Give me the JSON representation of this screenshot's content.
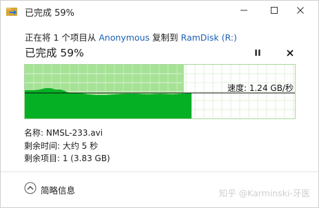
{
  "window": {
    "title": "已完成 59%",
    "icon": "copy-arrow-icon"
  },
  "header": {
    "copy_prefix": "正在将 1 个项目从 ",
    "source": "Anonymous",
    "copy_middle": " 复制到 ",
    "destination": "RamDisk (R:)",
    "progress_title": "已完成 59%",
    "progress_fraction": 0.59
  },
  "graph": {
    "speed_label": "速度: 1.24 GB/秒",
    "colors": {
      "completed_bg": "#a6e296",
      "fill": "#06b025",
      "grid_done": "#c4eebb",
      "grid_remaining": "#dff2da",
      "speed_line": "#111111"
    }
  },
  "details": {
    "name_label": "名称: ",
    "name_value": "NMSL-233.avi",
    "time_label": "剩余时间: ",
    "time_value": "大约 5 秒",
    "items_label": "剩余项目: ",
    "items_value": "1 (3.83 GB)"
  },
  "footer": {
    "toggle_label": "简略信息",
    "toggle_icon": "chevron-up-circle-icon",
    "watermark": "知乎 @Karminski-牙医"
  }
}
